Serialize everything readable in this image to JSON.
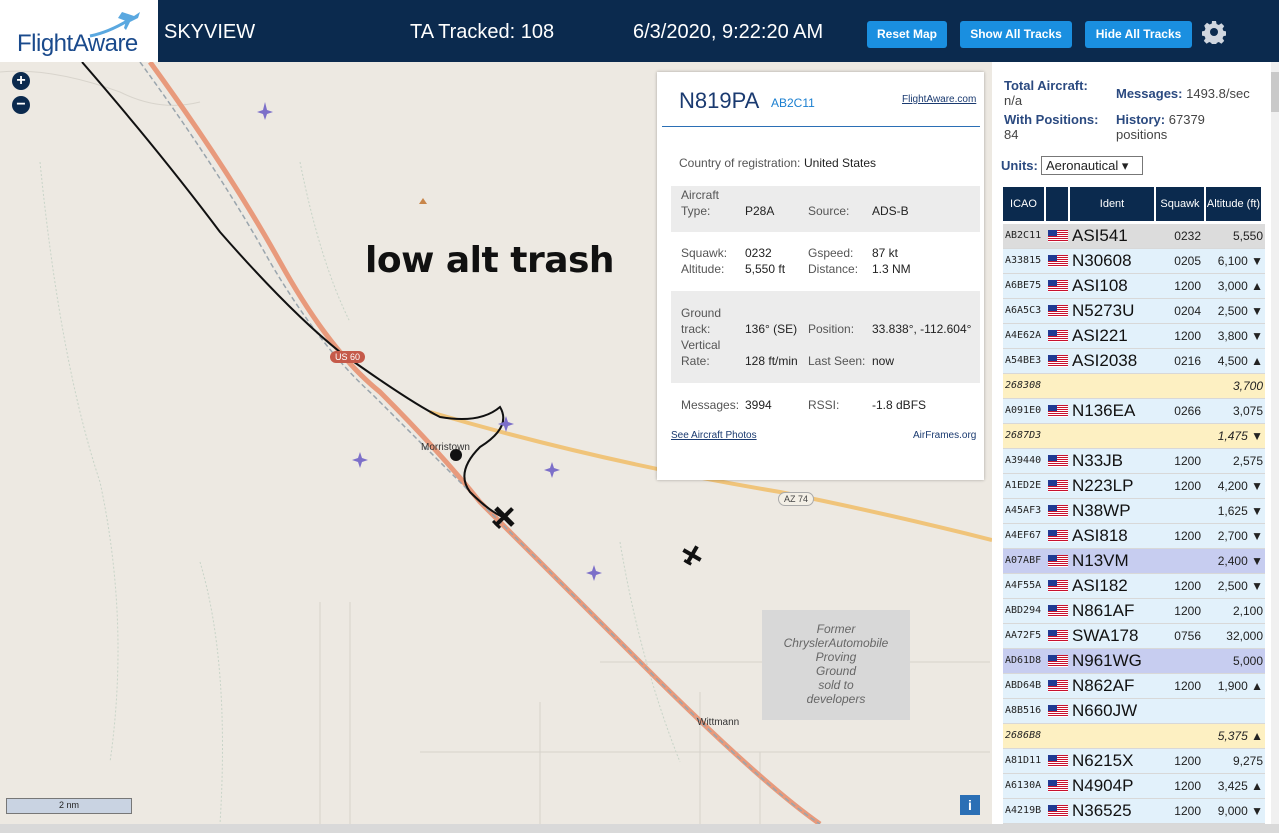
{
  "header": {
    "brand": "FlightAware",
    "app_name": "SKYVIEW",
    "tracked": "TA Tracked: 108",
    "datetime": "6/3/2020, 9:22:20 AM",
    "btn_reset": "Reset Map",
    "btn_show": "Show All Tracks",
    "btn_hide": "Hide All Tracks"
  },
  "map": {
    "annotation": "low alt trash",
    "town1": "Morristown",
    "town2": "Wittmann",
    "shield_us60": "US 60",
    "shield_az74": "AZ 74",
    "former_area": [
      "Former",
      "ChryslerAutomobile",
      "Proving",
      "Ground",
      "sold to",
      "developers"
    ],
    "scale": "2 nm",
    "info": "i",
    "zoom_in": "+",
    "zoom_out": "−"
  },
  "popup": {
    "registration": "N819PA",
    "hex": "AB2C11",
    "fa_link": "FlightAware.com",
    "country_label": "Country of registration:",
    "country_value": "United States",
    "aircraft_type_label1": "Aircraft",
    "aircraft_type_label2": "Type:",
    "aircraft_type": "P28A",
    "source_label": "Source:",
    "source": "ADS-B",
    "squawk_label": "Squawk:",
    "squawk": "0232",
    "altitude_label": "Altitude:",
    "altitude": "5,550 ft",
    "gspeed_label": "Gspeed:",
    "gspeed": "87 kt",
    "distance_label": "Distance:",
    "distance": "1.3 NM",
    "gtrack_label1": "Ground",
    "gtrack_label2": "track:",
    "gtrack": "136° (SE)",
    "position_label": "Position:",
    "position": "33.838°, -112.604°",
    "vrate_label1": "Vertical",
    "vrate_label2": "Rate:",
    "vrate": "128 ft/min",
    "last_seen_label": "Last Seen:",
    "last_seen": "now",
    "messages_label": "Messages:",
    "messages": "3994",
    "rssi_label": "RSSI:",
    "rssi": "-1.8 dBFS",
    "photos_link": "See Aircraft Photos",
    "airframes_link": "AirFrames.org"
  },
  "panel": {
    "total_label": "Total Aircraft:",
    "total_value": "n/a",
    "messages_label": "Messages:",
    "messages_value": "1493.8/sec",
    "withpos_label": "With Positions:",
    "withpos_value": "84",
    "history_label": "History:",
    "history_value": "67379",
    "history_unit": "positions",
    "units_label": "Units:",
    "units_value": "Aeronautical ▾",
    "columns": [
      "ICAO",
      "",
      "Ident",
      "Squawk",
      "Altitude (ft)"
    ],
    "rows": [
      {
        "icao": "AB2C11",
        "flag": true,
        "ident": "ASI541",
        "squawk": "0232",
        "alt": "5,550",
        "bg": "#dcdcdc"
      },
      {
        "icao": "A33815",
        "flag": true,
        "ident": "N30608",
        "squawk": "0205",
        "alt": "6,100 ▼",
        "bg": "#e2f1fb"
      },
      {
        "icao": "A6BE75",
        "flag": true,
        "ident": "ASI108",
        "squawk": "1200",
        "alt": "3,000 ▲",
        "bg": "#e2f1fb"
      },
      {
        "icao": "A6A5C3",
        "flag": true,
        "ident": "N5273U",
        "squawk": "0204",
        "alt": "2,500 ▼",
        "bg": "#e2f1fb"
      },
      {
        "icao": "A4E62A",
        "flag": true,
        "ident": "ASI221",
        "squawk": "1200",
        "alt": "3,800 ▼",
        "bg": "#e2f1fb"
      },
      {
        "icao": "A54BE3",
        "flag": true,
        "ident": "ASI2038",
        "squawk": "0216",
        "alt": "4,500 ▲",
        "bg": "#e2f1fb"
      },
      {
        "icao": "268308",
        "flag": false,
        "ident": "",
        "squawk": "",
        "alt": "3,700",
        "bg": "#fdf0c2",
        "yellow": true
      },
      {
        "icao": "A091E0",
        "flag": true,
        "ident": "N136EA",
        "squawk": "0266",
        "alt": "3,075",
        "bg": "#e2f1fb"
      },
      {
        "icao": "2687D3",
        "flag": false,
        "ident": "",
        "squawk": "",
        "alt": "1,475 ▼",
        "bg": "#fdf0c2",
        "yellow": true
      },
      {
        "icao": "A39440",
        "flag": true,
        "ident": "N33JB",
        "squawk": "1200",
        "alt": "2,575",
        "bg": "#e2f1fb"
      },
      {
        "icao": "A1ED2E",
        "flag": true,
        "ident": "N223LP",
        "squawk": "1200",
        "alt": "4,200 ▼",
        "bg": "#e2f1fb"
      },
      {
        "icao": "A45AF3",
        "flag": true,
        "ident": "N38WP",
        "squawk": "",
        "alt": "1,625 ▼",
        "bg": "#e2f1fb"
      },
      {
        "icao": "A4EF67",
        "flag": true,
        "ident": "ASI818",
        "squawk": "1200",
        "alt": "2,700 ▼",
        "bg": "#e2f1fb"
      },
      {
        "icao": "A07ABF",
        "flag": true,
        "ident": "N13VM",
        "squawk": "",
        "alt": "2,400 ▼",
        "bg": "#c7cdf0"
      },
      {
        "icao": "A4F55A",
        "flag": true,
        "ident": "ASI182",
        "squawk": "1200",
        "alt": "2,500 ▼",
        "bg": "#e2f1fb"
      },
      {
        "icao": "ABD294",
        "flag": true,
        "ident": "N861AF",
        "squawk": "1200",
        "alt": "2,100",
        "bg": "#e2f1fb"
      },
      {
        "icao": "AA72F5",
        "flag": true,
        "ident": "SWA178",
        "squawk": "0756",
        "alt": "32,000",
        "bg": "#e2f1fb"
      },
      {
        "icao": "AD61D8",
        "flag": true,
        "ident": "N961WG",
        "squawk": "",
        "alt": "5,000",
        "bg": "#c7cdf0"
      },
      {
        "icao": "ABD64B",
        "flag": true,
        "ident": "N862AF",
        "squawk": "1200",
        "alt": "1,900 ▲",
        "bg": "#e2f1fb"
      },
      {
        "icao": "A8B516",
        "flag": true,
        "ident": "N660JW",
        "squawk": "",
        "alt": "",
        "bg": "#e2f1fb"
      },
      {
        "icao": "2686B8",
        "flag": false,
        "ident": "",
        "squawk": "",
        "alt": "5,375 ▲",
        "bg": "#fdf0c2",
        "yellow": true
      },
      {
        "icao": "A81D11",
        "flag": true,
        "ident": "N6215X",
        "squawk": "1200",
        "alt": "9,275",
        "bg": "#e2f1fb"
      },
      {
        "icao": "A6130A",
        "flag": true,
        "ident": "N4904P",
        "squawk": "1200",
        "alt": "3,425 ▲",
        "bg": "#e2f1fb"
      },
      {
        "icao": "A4219B",
        "flag": true,
        "ident": "N36525",
        "squawk": "1200",
        "alt": "9,000 ▼",
        "bg": "#e2f1fb"
      }
    ]
  }
}
